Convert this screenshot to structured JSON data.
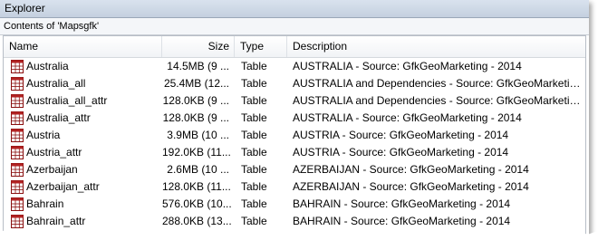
{
  "window": {
    "title": "Explorer",
    "contents_label": "Contents of 'Mapsgfk'"
  },
  "columns": {
    "name": "Name",
    "size": "Size",
    "type": "Type",
    "description": "Description"
  },
  "rows": [
    {
      "name": "Australia",
      "size": "14.5MB (9 ...",
      "type": "Table",
      "description": "AUSTRALIA - Source: GfkGeoMarketing - 2014"
    },
    {
      "name": "Australia_all",
      "size": "25.4MB (12...",
      "type": "Table",
      "description": "AUSTRALIA and Dependencies - Source: GfkGeoMarketing ..."
    },
    {
      "name": "Australia_all_attr",
      "size": "128.0KB (9 ...",
      "type": "Table",
      "description": "AUSTRALIA and Dependencies - Source: GfkGeoMarketing ..."
    },
    {
      "name": "Australia_attr",
      "size": "128.0KB (9 ...",
      "type": "Table",
      "description": "AUSTRALIA - Source: GfkGeoMarketing - 2014"
    },
    {
      "name": "Austria",
      "size": "3.9MB (10 ...",
      "type": "Table",
      "description": "AUSTRIA - Source: GfkGeoMarketing - 2014"
    },
    {
      "name": "Austria_attr",
      "size": "192.0KB (11...",
      "type": "Table",
      "description": "AUSTRIA - Source: GfkGeoMarketing - 2014"
    },
    {
      "name": "Azerbaijan",
      "size": "2.6MB (10 ...",
      "type": "Table",
      "description": "AZERBAIJAN - Source: GfkGeoMarketing - 2014"
    },
    {
      "name": "Azerbaijan_attr",
      "size": "128.0KB (11...",
      "type": "Table",
      "description": "AZERBAIJAN - Source: GfkGeoMarketing - 2014"
    },
    {
      "name": "Bahrain",
      "size": "576.0KB (10...",
      "type": "Table",
      "description": "BAHRAIN - Source: GfkGeoMarketing - 2014"
    },
    {
      "name": "Bahrain_attr",
      "size": "288.0KB (13...",
      "type": "Table",
      "description": "BAHRAIN - Source: GfkGeoMarketing - 2014"
    }
  ],
  "icon": "table-icon"
}
